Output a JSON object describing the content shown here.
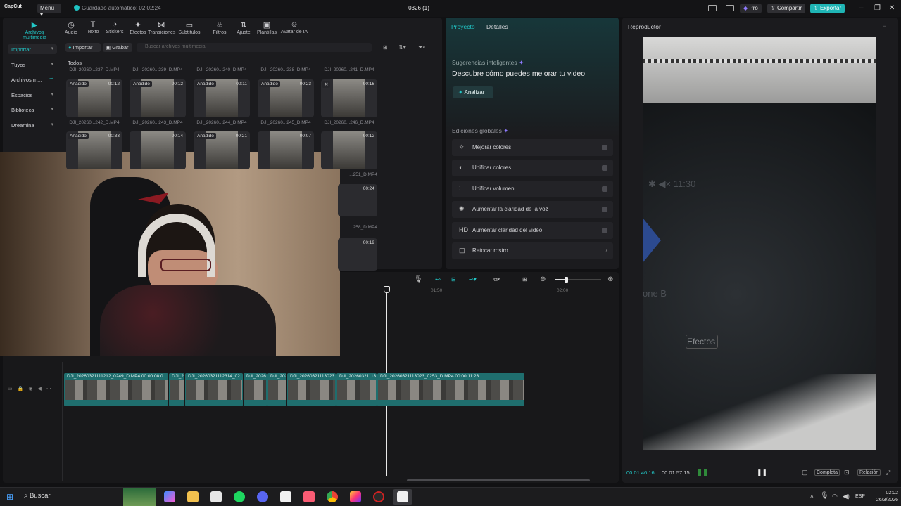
{
  "titlebar": {
    "app_logo": "CapCut",
    "menu_label": "Menú",
    "autosave": "Guardado automático: 02:02:24",
    "project_title": "0326 (1)",
    "pro_label": "Pro",
    "share_label": "Compartir",
    "export_label": "Exportar"
  },
  "toolbar": [
    {
      "label": "Archivos multimedia",
      "icon": "media-icon",
      "glyph": "▶",
      "active": true
    },
    {
      "label": "Audio",
      "icon": "audio-icon",
      "glyph": "◷"
    },
    {
      "label": "Texto",
      "icon": "text-icon",
      "glyph": "T"
    },
    {
      "label": "Stickers",
      "icon": "sticker-icon",
      "glyph": "◔"
    },
    {
      "label": "Efectos",
      "icon": "effects-icon",
      "glyph": "✦"
    },
    {
      "label": "Transiciones",
      "icon": "transitions-icon",
      "glyph": "⋈"
    },
    {
      "label": "Subtítulos",
      "icon": "subtitles-icon",
      "glyph": "▭"
    },
    {
      "label": "Filtros",
      "icon": "filters-icon",
      "glyph": "♧"
    },
    {
      "label": "Ajuste",
      "icon": "adjust-icon",
      "glyph": "⇅"
    },
    {
      "label": "Plantillas",
      "icon": "templates-icon",
      "glyph": "▣"
    },
    {
      "label": "Avatar de IA",
      "icon": "avatar-icon",
      "glyph": "☺"
    }
  ],
  "sidebar": [
    {
      "label": "Importar",
      "selected": true
    },
    {
      "label": "Tuyos"
    },
    {
      "label": "Archivos m..."
    },
    {
      "label": "Espacios"
    },
    {
      "label": "Biblioteca"
    },
    {
      "label": "Dreamina"
    }
  ],
  "media": {
    "import_label": "Importar",
    "record_label": "Grabar",
    "search_placeholder": "Buscar archivos multimedia",
    "section_label": "Todos",
    "row1": [
      {
        "name": "DJI_20260...237_D.MP4",
        "badge": "Añadido",
        "dur": "00:12"
      },
      {
        "name": "DJI_20260...239_D.MP4",
        "badge": "Añadido",
        "dur": "00:12"
      },
      {
        "name": "DJI_20260...240_D.MP4",
        "badge": "Añadido",
        "dur": "00:11"
      },
      {
        "name": "DJI_20260...238_D.MP4",
        "badge": "Añadido",
        "dur": "00:23"
      },
      {
        "name": "DJI_20260...241_D.MP4",
        "badge": "",
        "dur": "00:16"
      }
    ],
    "row2": [
      {
        "name": "DJI_20260...242_D.MP4",
        "badge": "Añadido",
        "dur": "00:33"
      },
      {
        "name": "DJI_20260...243_D.MP4",
        "badge": "",
        "dur": "00:14"
      },
      {
        "name": "DJI_20260...244_D.MP4",
        "badge": "Añadido",
        "dur": "00:21"
      },
      {
        "name": "DJI_20260...245_D.MP4",
        "badge": "",
        "dur": "00:07"
      },
      {
        "name": "DJI_20260...246_D.MP4",
        "badge": "",
        "dur": "00:12"
      }
    ],
    "extra_names": [
      "...251_D.MP4",
      "...258_D.MP4"
    ],
    "extra_durs": [
      "00:24",
      "00:19"
    ]
  },
  "project_panel": {
    "tab_project": "Proyecto",
    "tab_details": "Detalles",
    "smart_title": "Sugerencias inteligentes",
    "smart_headline": "Descubre cómo puedes mejorar tu video",
    "analyze_label": "Analizar",
    "global_title": "Ediciones globales",
    "global_items": [
      {
        "label": "Mejorar colores",
        "icon": "magic-wand-icon",
        "glyph": "✧"
      },
      {
        "label": "Unificar colores",
        "icon": "palette-icon",
        "glyph": "◐"
      },
      {
        "label": "Unificar volumen",
        "icon": "volume-bars-icon",
        "glyph": "⫶"
      },
      {
        "label": "Aumentar la claridad de la voz",
        "icon": "voice-icon",
        "glyph": "✺"
      },
      {
        "label": "Aumentar claridad del video",
        "icon": "hd-icon",
        "glyph": "HD"
      },
      {
        "label": "Retocar rostro",
        "icon": "face-icon",
        "glyph": "◫"
      }
    ]
  },
  "player": {
    "title": "Reproductor",
    "current_time": "00:01:46:16",
    "total_time": "00:01:57:15",
    "full_label": "Completa",
    "ratio_label": "Relación",
    "video_text_clock": "11:30",
    "video_text_one": "one B",
    "video_text_effects": "Efectos"
  },
  "timeline": {
    "ruler_marks": [
      "01:50",
      "02:00"
    ],
    "clips": [
      {
        "label": "DJI_20260321111212_0249_D.MP4  00:00:08:0"
      },
      {
        "label": "DJI_20"
      },
      {
        "label": "DJI_20260321112314_02"
      },
      {
        "label": "DJI_2026"
      },
      {
        "label": "DJI_202"
      },
      {
        "label": "DJI_20260321113023"
      },
      {
        "label": "DJI_20260321113"
      },
      {
        "label": "DJI_20260321113023_0253_D.MP4  00:00:11:23"
      }
    ]
  },
  "taskbar": {
    "search_label": "Buscar",
    "language": "ESP",
    "time": "02:02",
    "date": "26/3/2026"
  }
}
